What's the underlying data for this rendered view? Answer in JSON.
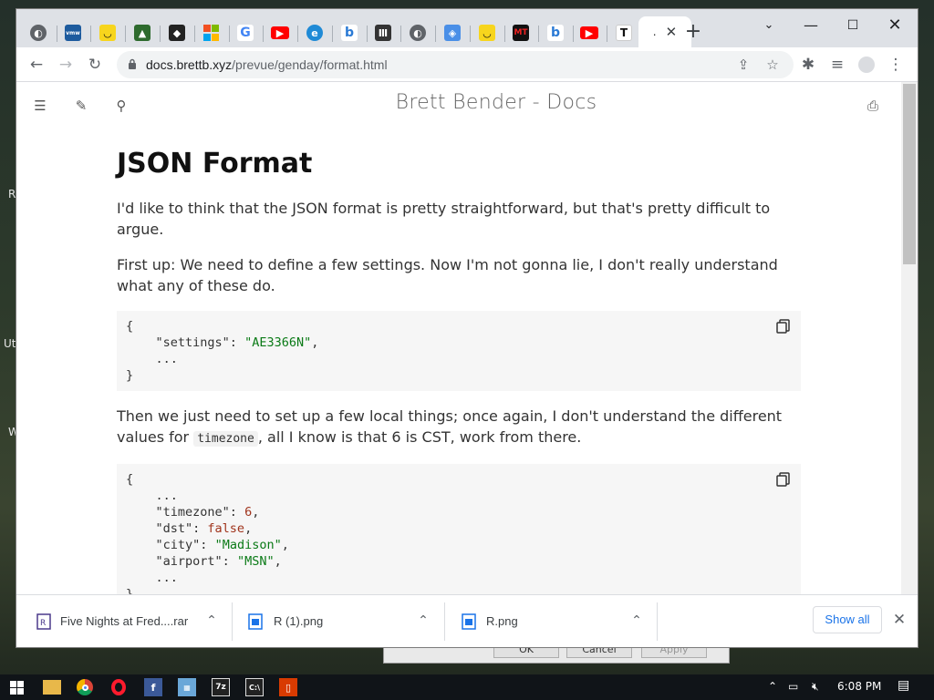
{
  "browser": {
    "url_host": "docs.brettb.xyz",
    "url_path": "/prevue/genday/format.html",
    "active_tab_label": "."
  },
  "page": {
    "site_title": "Brett Bender - Docs",
    "heading": "JSON Format",
    "para1": "I'd like to think that the JSON format is pretty straightforward, but that's pretty difficult to argue.",
    "para2": "First up: We need to define a few settings. Now I'm not gonna lie, I don't really understand what any of these do.",
    "para3_before": "Then we just need to set up a few local things; once again, I don't understand the different values for",
    "para3_code": "timezone",
    "para3_after": ", all I know is that 6 is CST, work from there.",
    "code1": {
      "open": "{",
      "key": "\"settings\"",
      "value": "\"AE3366N\"",
      "ellipsis": "...",
      "close": "}"
    },
    "code2": {
      "open": "{",
      "ellipsis": "...",
      "tz_key": "\"timezone\"",
      "tz_val": "6",
      "dst_key": "\"dst\"",
      "dst_val": "false",
      "city_key": "\"city\"",
      "city_val": "\"Madison\"",
      "airport_key": "\"airport\"",
      "airport_val": "\"MSN\"",
      "close": "}"
    }
  },
  "downloads": {
    "items": [
      {
        "name": "Five Nights at Fred....rar"
      },
      {
        "name": "R (1).png"
      },
      {
        "name": "R.png"
      }
    ],
    "show_all_label": "Show all"
  },
  "taskbar": {
    "time": "6:08 PM"
  },
  "desktop": {
    "label_r": "R",
    "label_ut": "Ut",
    "label_w": "W"
  },
  "bg_dialog": {
    "ok": "OK",
    "cancel": "Cancel",
    "apply": "Apply"
  },
  "colors": {
    "accent": "#1a73e8",
    "code_string": "#0a7a16",
    "code_number": "#a0341c"
  }
}
